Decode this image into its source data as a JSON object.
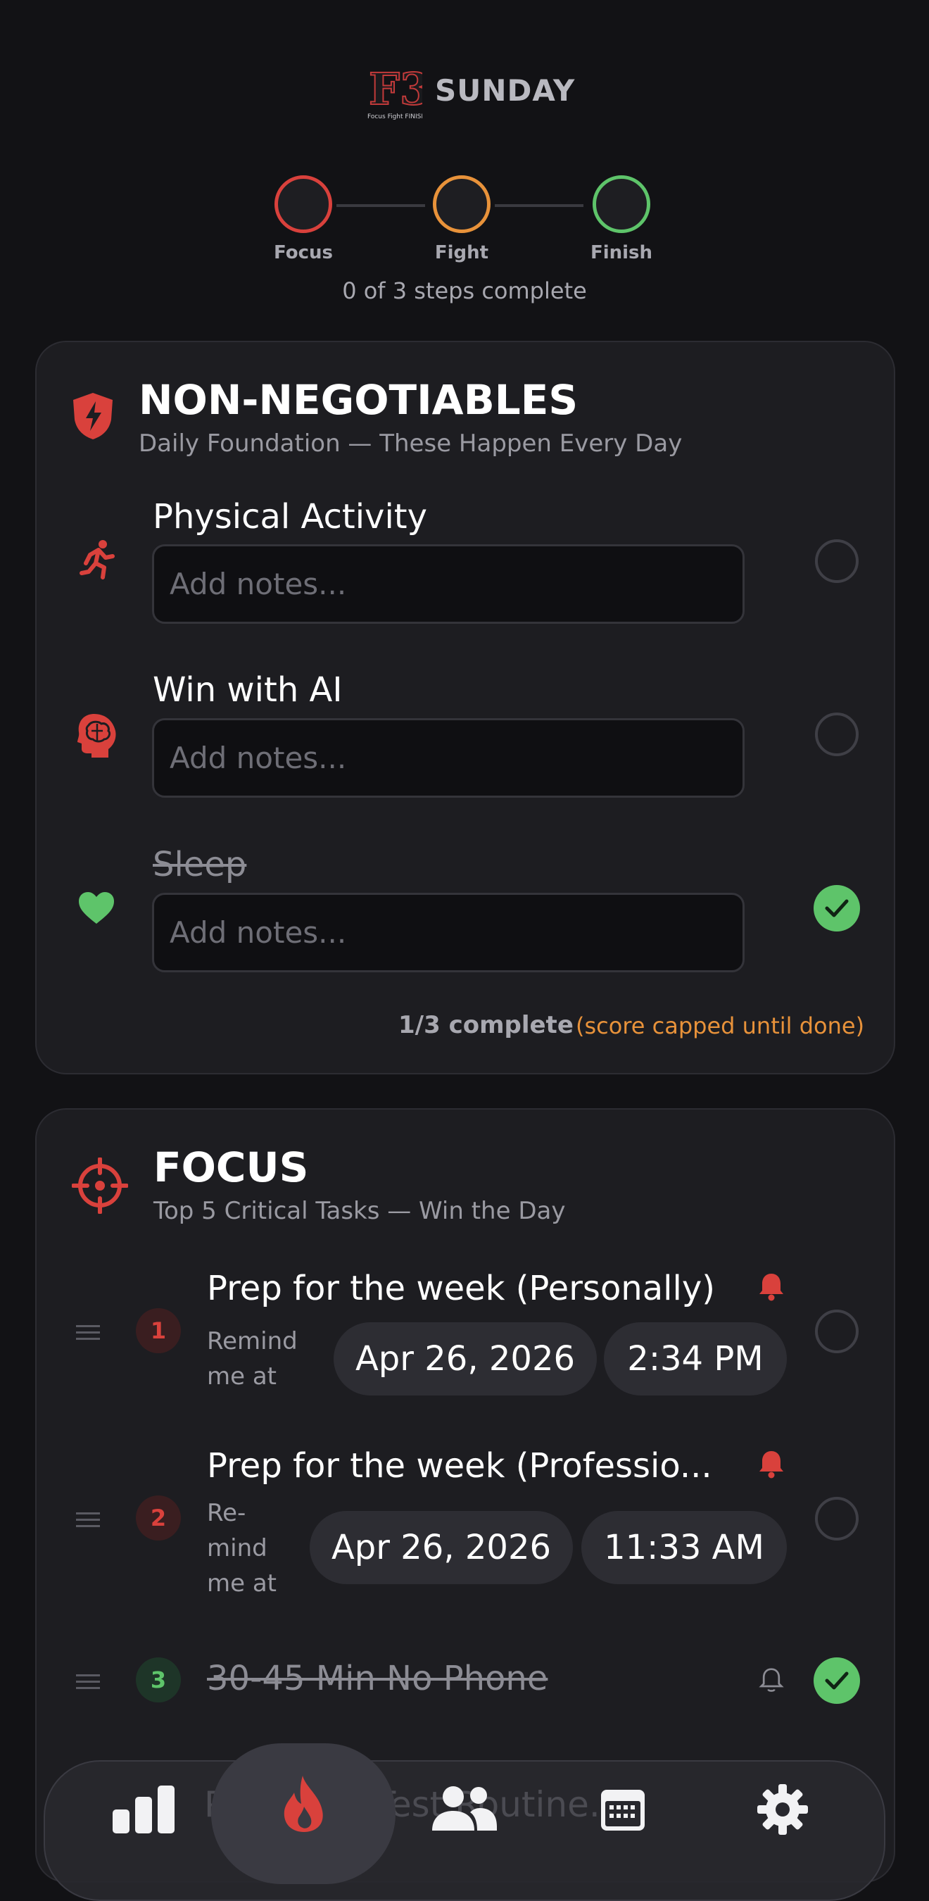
{
  "header": {
    "day": "SUNDAY",
    "logo_text": "F3",
    "logo_tagline": "Focus Fight FINISH"
  },
  "steps": {
    "items": [
      {
        "label": "Focus",
        "color": "#d9413c"
      },
      {
        "label": "Fight",
        "color": "#e8923a"
      },
      {
        "label": "Finish",
        "color": "#5ec46a"
      }
    ],
    "status": "0 of 3 steps complete"
  },
  "non_negotiables": {
    "title": "NON-NEGOTIABLES",
    "subtitle": "Daily Foundation — These Happen Every Day",
    "items": [
      {
        "title": "Physical Activity",
        "icon": "running-icon",
        "notes_placeholder": "Add notes...",
        "done": false
      },
      {
        "title": "Win with AI",
        "icon": "brain-head-icon",
        "notes_placeholder": "Add notes...",
        "done": false
      },
      {
        "title": "Sleep",
        "icon": "heart-icon",
        "notes_placeholder": "Add notes...",
        "done": true
      }
    ],
    "summary_count": "1/3 complete",
    "summary_note": "(score capped until done)"
  },
  "focus": {
    "title": "FOCUS",
    "subtitle": "Top 5 Critical Tasks — Win the Day",
    "tasks": [
      {
        "number": "1",
        "title": "Prep for the week (Personally)",
        "remind_label_lines": [
          "Remind",
          "me at"
        ],
        "date": "Apr 26, 2026",
        "time": "2:34 PM",
        "done": false
      },
      {
        "number": "2",
        "title": "Prep for the week (Professio...",
        "remind_label_lines": [
          "Re-",
          "mind",
          "me at"
        ],
        "date": "Apr 26, 2026",
        "time": "11:33 AM",
        "done": false
      },
      {
        "number": "3",
        "title": "30-45 Min No Phone",
        "done": true
      }
    ],
    "ghost_text": "Prompt a Test Routine..."
  },
  "nav": {
    "items": [
      {
        "icon": "bar-chart-icon"
      },
      {
        "icon": "flame-icon",
        "active": true
      },
      {
        "icon": "people-icon"
      },
      {
        "icon": "calendar-icon"
      },
      {
        "icon": "gear-icon"
      }
    ]
  },
  "colors": {
    "accent_red": "#d9413c",
    "accent_orange": "#e8923a",
    "accent_green": "#5ec46a"
  }
}
